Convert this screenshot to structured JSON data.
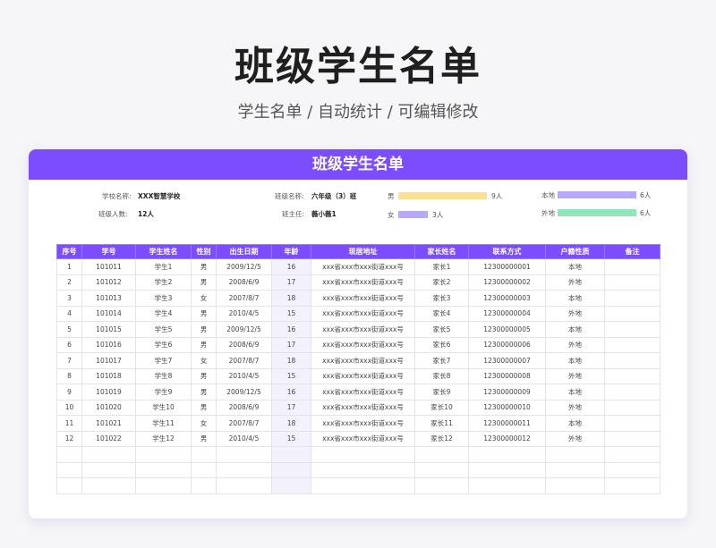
{
  "page": {
    "title": "班级学生名单",
    "subtitle": "学生名单 / 自动统计 / 可编辑修改"
  },
  "card": {
    "header": "班级学生名单"
  },
  "info": {
    "school_label": "学校名称:",
    "school_value": "XXX智慧学校",
    "class_label": "班级名称:",
    "class_value": "六年级（3）班",
    "count_label": "班级人数:",
    "count_value": "12人",
    "teacher_label": "班主任:",
    "teacher_value": "薇小薇1"
  },
  "stats": {
    "gender": [
      {
        "label": "男",
        "value": "9人",
        "count": 9,
        "color": "#fbe08f"
      },
      {
        "label": "女",
        "value": "3人",
        "count": 3,
        "color": "#b9a7f7"
      }
    ],
    "residence": [
      {
        "label": "本地",
        "value": "6人",
        "count": 6,
        "color": "#b9a7f7"
      },
      {
        "label": "外地",
        "value": "6人",
        "count": 6,
        "color": "#8fe6b8"
      }
    ]
  },
  "table": {
    "headers": [
      "序号",
      "学号",
      "学生姓名",
      "性别",
      "出生日期",
      "年龄",
      "现居地址",
      "家长姓名",
      "联系方式",
      "户籍性质",
      "备注"
    ],
    "rows": [
      [
        "1",
        "101011",
        "学生1",
        "男",
        "2009/12/5",
        "16",
        "xxx省xxx市xxx街道xxx号",
        "家长1",
        "12300000001",
        "本地",
        ""
      ],
      [
        "2",
        "101012",
        "学生2",
        "男",
        "2008/6/9",
        "17",
        "xxx省xxx市xxx街道xxx号",
        "家长2",
        "12300000002",
        "外地",
        ""
      ],
      [
        "3",
        "101013",
        "学生3",
        "女",
        "2007/8/7",
        "18",
        "xxx省xxx市xxx街道xxx号",
        "家长3",
        "12300000003",
        "本地",
        ""
      ],
      [
        "4",
        "101014",
        "学生4",
        "男",
        "2010/4/5",
        "15",
        "xxx省xxx市xxx街道xxx号",
        "家长4",
        "12300000004",
        "外地",
        ""
      ],
      [
        "5",
        "101015",
        "学生5",
        "男",
        "2009/12/5",
        "16",
        "xxx省xxx市xxx街道xxx号",
        "家长5",
        "12300000005",
        "本地",
        ""
      ],
      [
        "6",
        "101016",
        "学生6",
        "男",
        "2008/6/9",
        "17",
        "xxx省xxx市xxx街道xxx号",
        "家长6",
        "12300000006",
        "外地",
        ""
      ],
      [
        "7",
        "101017",
        "学生7",
        "女",
        "2007/8/7",
        "18",
        "xxx省xxx市xxx街道xxx号",
        "家长7",
        "12300000007",
        "本地",
        ""
      ],
      [
        "8",
        "101018",
        "学生8",
        "男",
        "2010/4/5",
        "15",
        "xxx省xxx市xxx街道xxx号",
        "家长8",
        "12300000008",
        "外地",
        ""
      ],
      [
        "9",
        "101019",
        "学生9",
        "男",
        "2009/12/5",
        "16",
        "xxx省xxx市xxx街道xxx号",
        "家长9",
        "12300000009",
        "本地",
        ""
      ],
      [
        "10",
        "101020",
        "学生10",
        "男",
        "2008/6/9",
        "17",
        "xxx省xxx市xxx街道xxx号",
        "家长10",
        "12300000010",
        "外地",
        ""
      ],
      [
        "11",
        "101021",
        "学生11",
        "女",
        "2007/8/7",
        "18",
        "xxx省xxx市xxx街道xxx号",
        "家长11",
        "12300000011",
        "本地",
        ""
      ],
      [
        "12",
        "101022",
        "学生12",
        "男",
        "2010/4/5",
        "15",
        "xxx省xxx市xxx街道xxx号",
        "家长12",
        "12300000012",
        "外地",
        ""
      ],
      [
        "",
        "",
        "",
        "",
        "",
        "",
        "",
        "",
        "",
        "",
        ""
      ],
      [
        "",
        "",
        "",
        "",
        "",
        "",
        "",
        "",
        "",
        "",
        ""
      ],
      [
        "",
        "",
        "",
        "",
        "",
        "",
        "",
        "",
        "",
        "",
        ""
      ]
    ]
  }
}
